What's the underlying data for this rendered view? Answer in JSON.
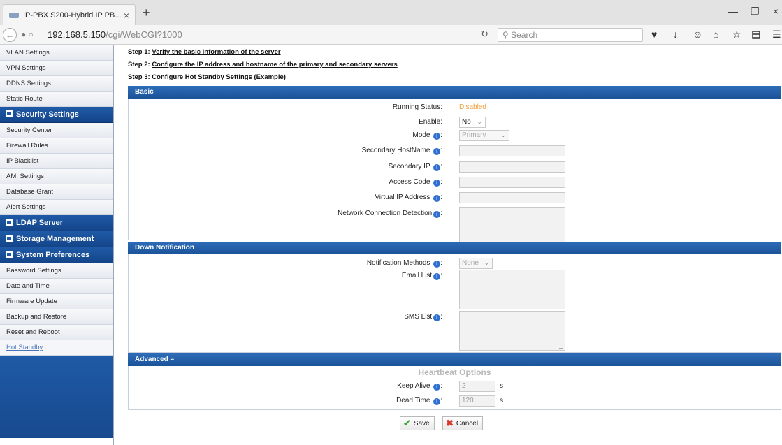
{
  "browser": {
    "tab_title": "IP-PBX S200-Hybrid IP PB...",
    "tab_close": "×",
    "new_tab": "+",
    "url_host": "192.168.5.150",
    "url_path": "/cgi/WebCGI?1000",
    "search_placeholder": "Search",
    "window_min": "—",
    "window_max": "❐",
    "window_close": "×"
  },
  "sidebar": {
    "group0": [
      "VLAN Settings",
      "VPN Settings",
      "DDNS Settings",
      "Static Route"
    ],
    "security_head": "Security Settings",
    "security_items": [
      "Security Center",
      "Firewall Rules",
      "IP Blacklist",
      "AMI Settings",
      "Database Grant",
      "Alert Settings"
    ],
    "ldap_head": "LDAP Server",
    "storage_head": "Storage Management",
    "sysprefs_head": "System Preferences",
    "sysprefs_items": [
      "Password Settings",
      "Date and Time",
      "Firmware Update",
      "Backup and Restore",
      "Reset and Reboot"
    ],
    "active_item": "Hot Standby"
  },
  "steps": {
    "s1_prefix": "Step 1: ",
    "s1_link": "Verify the basic information of the server",
    "s2_prefix": "Step 2: ",
    "s2_link": "Configure the IP address and hostname of the primary and secondary servers",
    "s3_prefix": "Step 3: Configure Hot Standby Settings ",
    "s3_link": "(Example)"
  },
  "basic": {
    "title": "Basic",
    "running_status_label": "Running Status:",
    "running_status_value": "Disabled",
    "running_status_color": "#f0a040",
    "enable_label": "Enable:",
    "enable_value": "No",
    "mode_label": "Mode",
    "mode_value": "Primary",
    "secondary_hostname_label": "Secondary HostName",
    "secondary_ip_label": "Secondary IP",
    "access_code_label": "Access Code",
    "virtual_ip_label": "Virtual IP Address",
    "network_detection_label": "Network Connection Detection"
  },
  "down_notification": {
    "title": "Down Notification",
    "methods_label": "Notification Methods",
    "methods_value": "None",
    "email_label": "Email List",
    "sms_label": "SMS List"
  },
  "advanced": {
    "title": "Advanced",
    "toggle_icon": "≈",
    "heartbeat_title": "Heartbeat Options",
    "keep_alive_label": "Keep Alive",
    "keep_alive_value": "2",
    "dead_time_label": "Dead Time",
    "dead_time_value": "120",
    "unit": "s"
  },
  "actions": {
    "save": "Save",
    "cancel": "Cancel"
  },
  "colors": {
    "header_blue": "#1f5aa6",
    "accent_link": "#4a74b8"
  }
}
